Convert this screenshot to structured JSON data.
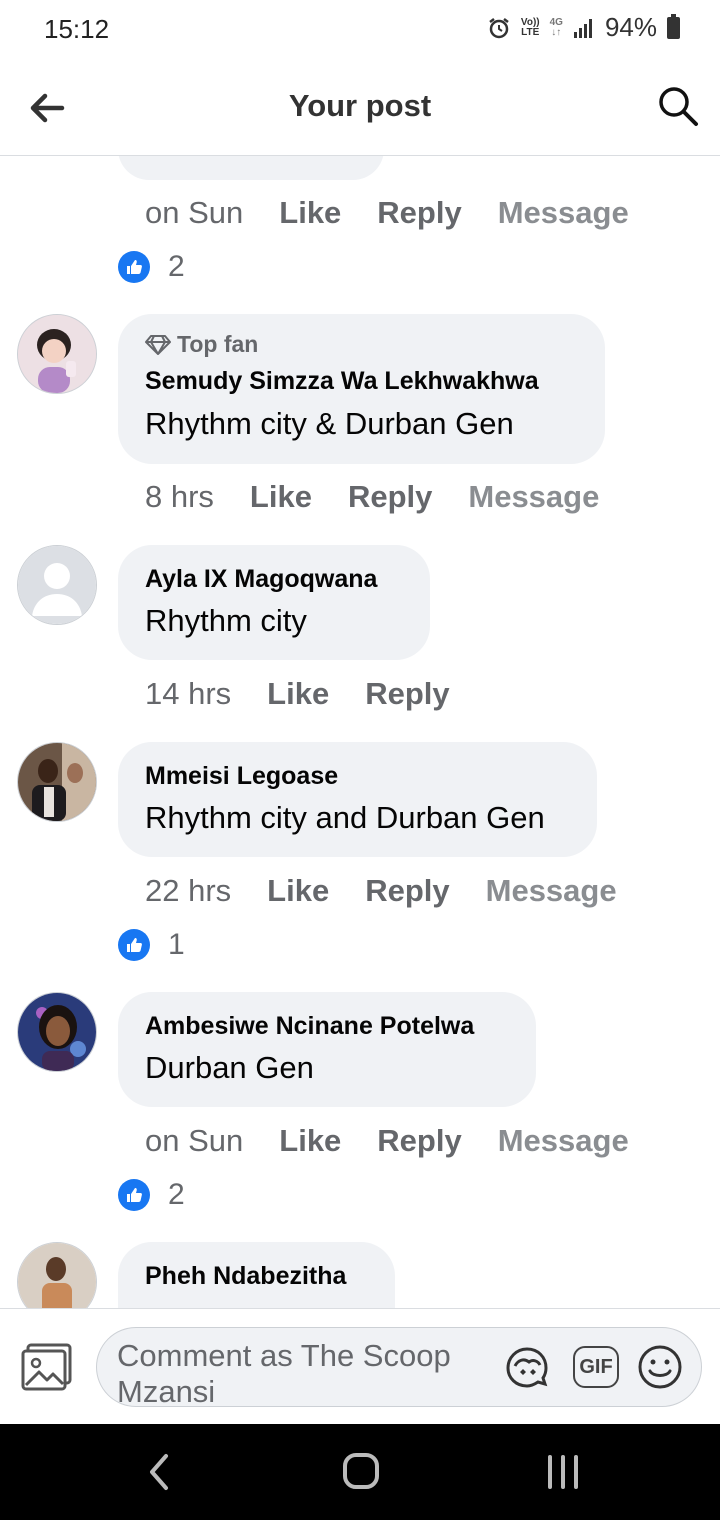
{
  "status": {
    "time": "15:12",
    "volte_top": "Vo))",
    "volte_bottom": "LTE",
    "network": "4G",
    "battery": "94%"
  },
  "header": {
    "title": "Your post"
  },
  "actions": {
    "like": "Like",
    "reply": "Reply",
    "message": "Message"
  },
  "comments": [
    {
      "time": "on Sun",
      "reactions": "2"
    },
    {
      "badge": "Top fan",
      "author": "Semudy Simzza Wa Lekhwakhwa",
      "text": "Rhythm city & Durban Gen",
      "time": "8 hrs"
    },
    {
      "author": "Ayla IX Magoqwana",
      "text": "Rhythm city",
      "time": "14 hrs"
    },
    {
      "author": "Mmeisi Legoase",
      "text": "Rhythm city and Durban Gen",
      "time": "22 hrs",
      "reactions": "1"
    },
    {
      "author": "Ambesiwe Ncinane Potelwa",
      "text": "Durban Gen",
      "time": "on Sun",
      "reactions": "2"
    },
    {
      "author": "Pheh Ndabezitha"
    }
  ],
  "composer": {
    "placeholder": "Comment as The Scoop Mzansi",
    "gif_label": "GIF"
  },
  "colors": {
    "accent": "#1877f2",
    "bubble": "#f0f2f5",
    "muted_text": "#65676b"
  }
}
